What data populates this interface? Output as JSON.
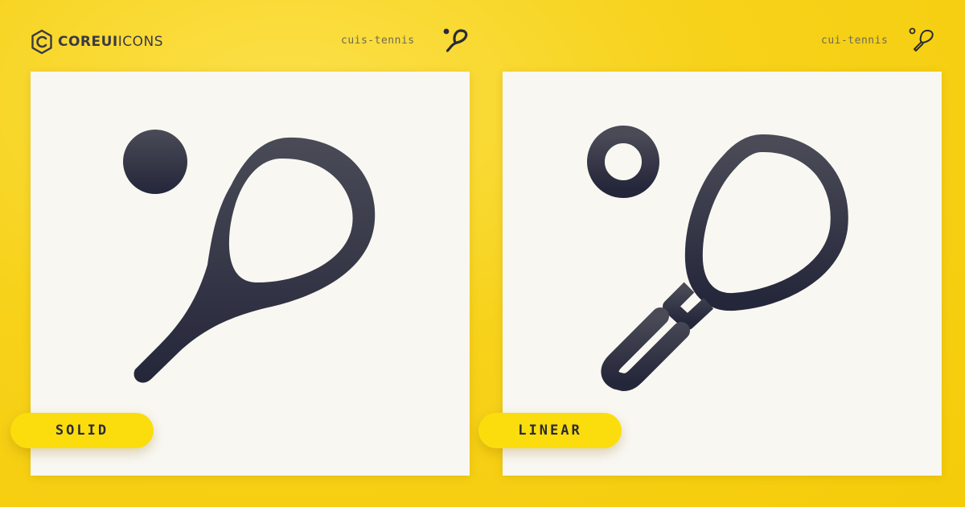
{
  "brand": {
    "logo_bold": "COREUI",
    "logo_thin": "ICONS",
    "icon_ink": "#3d3e4a"
  },
  "variants": [
    {
      "icon_name": "cuis-tennis",
      "badge": "SOLID",
      "icon": "tennis-racket-solid-icon"
    },
    {
      "icon_name": "cui-tennis",
      "badge": "LINEAR",
      "icon": "tennis-racket-linear-icon"
    }
  ],
  "colors": {
    "background": "#f7d21a",
    "card": "#f8f7f1",
    "badge": "#fbdd0e",
    "icon_top": "#4a4b57",
    "icon_bottom": "#24263a"
  }
}
